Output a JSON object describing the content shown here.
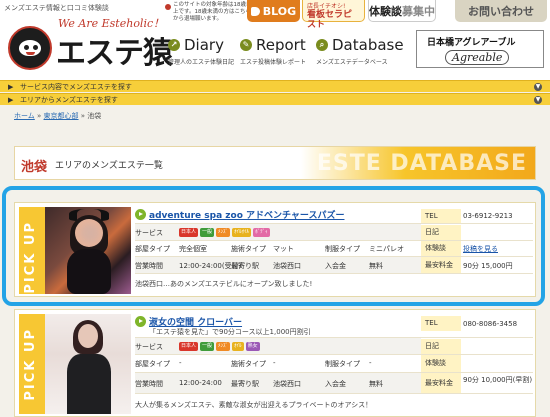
{
  "header": {
    "tagline": "メンズエステ情報と口コミ体験談",
    "slogan": "We Are Esteholic！",
    "logo_text": "エステ猿",
    "notice": "このサイトの対象年齢は18歳以上です。18歳未満の方はこちらから退場願います。",
    "blog_label": "BLOG",
    "therapist_small": "店長イチオシ!",
    "therapist_big": "看板セラピスト",
    "taiken_main": "体験談",
    "taiken_muted": "募集中",
    "contact_label": "お問い合わせ",
    "nav": [
      {
        "label": "Diary",
        "sub": "管理人のエステ体験日記",
        "icon": "diary-icon"
      },
      {
        "label": "Report",
        "sub": "エステ投稿体験レポート",
        "icon": "report-icon"
      },
      {
        "label": "Database",
        "sub": "メンズエステデータベース",
        "icon": "database-icon"
      }
    ],
    "banner_line1": "日本橋アグレアーブル",
    "banner_line2": "Agreable"
  },
  "search": {
    "service": "サービス内容でメンズエステを探す",
    "area": "エリアからメンズエステを探す"
  },
  "breadcrumb": {
    "home": "ホーム",
    "sep1": " » ",
    "region": "東京都心部",
    "sep2": " » ",
    "current": "池袋"
  },
  "section": {
    "title": "池袋",
    "suffix": "エリアのメンズエステ一覧",
    "bg_word": "ESTE DATABASE"
  },
  "labels": {
    "pickup": "PICK UP",
    "service": "サービス",
    "room_type": "部屋タイプ",
    "facility_type": "施術タイプ",
    "uniform_type": "制服タイプ",
    "hours": "営業時間",
    "station": "最寄り駅",
    "admission": "入会金",
    "tel": "TEL",
    "diary": "日記",
    "review": "体験談",
    "min_fee": "最安料金"
  },
  "cards": [
    {
      "name": "adventure spa zoo アドベンチャースパズー",
      "sub_note": "",
      "tags": [
        {
          "text": "日本人",
          "color": "#d9362b"
        },
        {
          "text": "一般",
          "color": "#3f9c3a"
        },
        {
          "text": "ﾒﾝｽﾞ",
          "color": "#f08a24"
        },
        {
          "text": "ｵｲﾙｵｲﾙ",
          "color": "#e8b21e"
        },
        {
          "text": "ﾎﾞﾃﾞｨ",
          "color": "#e36aa6"
        }
      ],
      "room_type": "完全個室",
      "facility_type": "マット",
      "uniform_type": "ミニパレオ",
      "hours": "12:00-24:00(受付)",
      "station": "池袋西口",
      "admission": "無料",
      "tel": "03-6912-9213",
      "diary": "",
      "review": "投稿を見る",
      "min_fee": "90分 15,000円",
      "note": "池袋西口…あのメンズエステビルにオープン致しました!"
    },
    {
      "name": "淑女の空間 クローバー",
      "sub_note": "「エステ猿を見た」で90分コース以上1,000円割引",
      "tags": [
        {
          "text": "日本人",
          "color": "#d9362b"
        },
        {
          "text": "一般",
          "color": "#3f9c3a"
        },
        {
          "text": "ﾒﾝｽﾞ",
          "color": "#f08a24"
        },
        {
          "text": "ｵｲﾙ",
          "color": "#e8b21e"
        },
        {
          "text": "熟女",
          "color": "#9b59b6"
        }
      ],
      "room_type": "-",
      "facility_type": "-",
      "uniform_type": "-",
      "hours": "12:00-24:00",
      "station": "池袋西口",
      "admission": "無料",
      "tel": "080-8086-3458",
      "diary": "",
      "review": "",
      "min_fee": "90分 10,000円(早割)",
      "note": "大人が集るメンズエステ、素敵な淑女が出迎えるプライベートのオアシス！"
    }
  ]
}
